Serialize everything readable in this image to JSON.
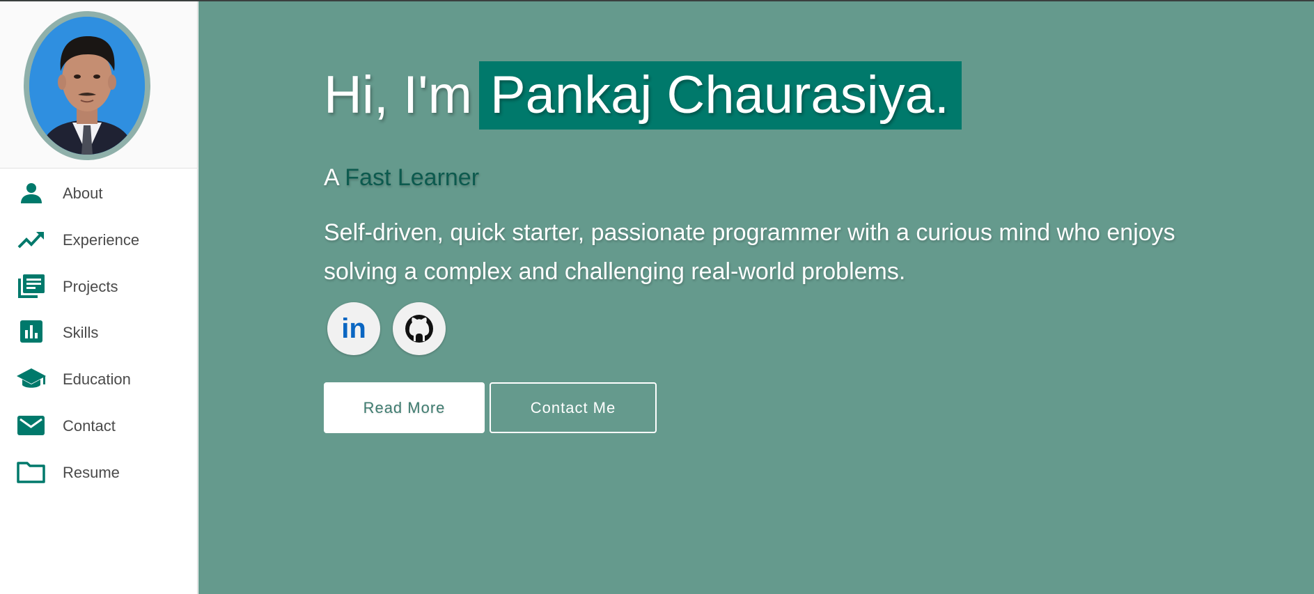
{
  "sidebar": {
    "items": [
      {
        "label": "About",
        "icon": "person-icon"
      },
      {
        "label": "Experience",
        "icon": "trending-up-icon"
      },
      {
        "label": "Projects",
        "icon": "library-books-icon"
      },
      {
        "label": "Skills",
        "icon": "bar-chart-icon"
      },
      {
        "label": "Education",
        "icon": "school-icon"
      },
      {
        "label": "Contact",
        "icon": "mail-icon"
      },
      {
        "label": "Resume",
        "icon": "folder-icon"
      }
    ]
  },
  "hero": {
    "greeting": "Hi, I'm",
    "name": "Pankaj Chaurasiya.",
    "subtitle_prefix": "A",
    "subtitle_accent": "Fast Learner",
    "description": "Self-driven, quick starter, passionate programmer with a curious mind who enjoys solving a complex and challenging real-world problems."
  },
  "social": {
    "linkedin_text": "in"
  },
  "buttons": {
    "read_more": "Read More",
    "contact_me": "Contact Me"
  },
  "colors": {
    "accent": "#00796b",
    "main_bg": "#659a8d",
    "sidebar_bg": "#ffffff"
  }
}
